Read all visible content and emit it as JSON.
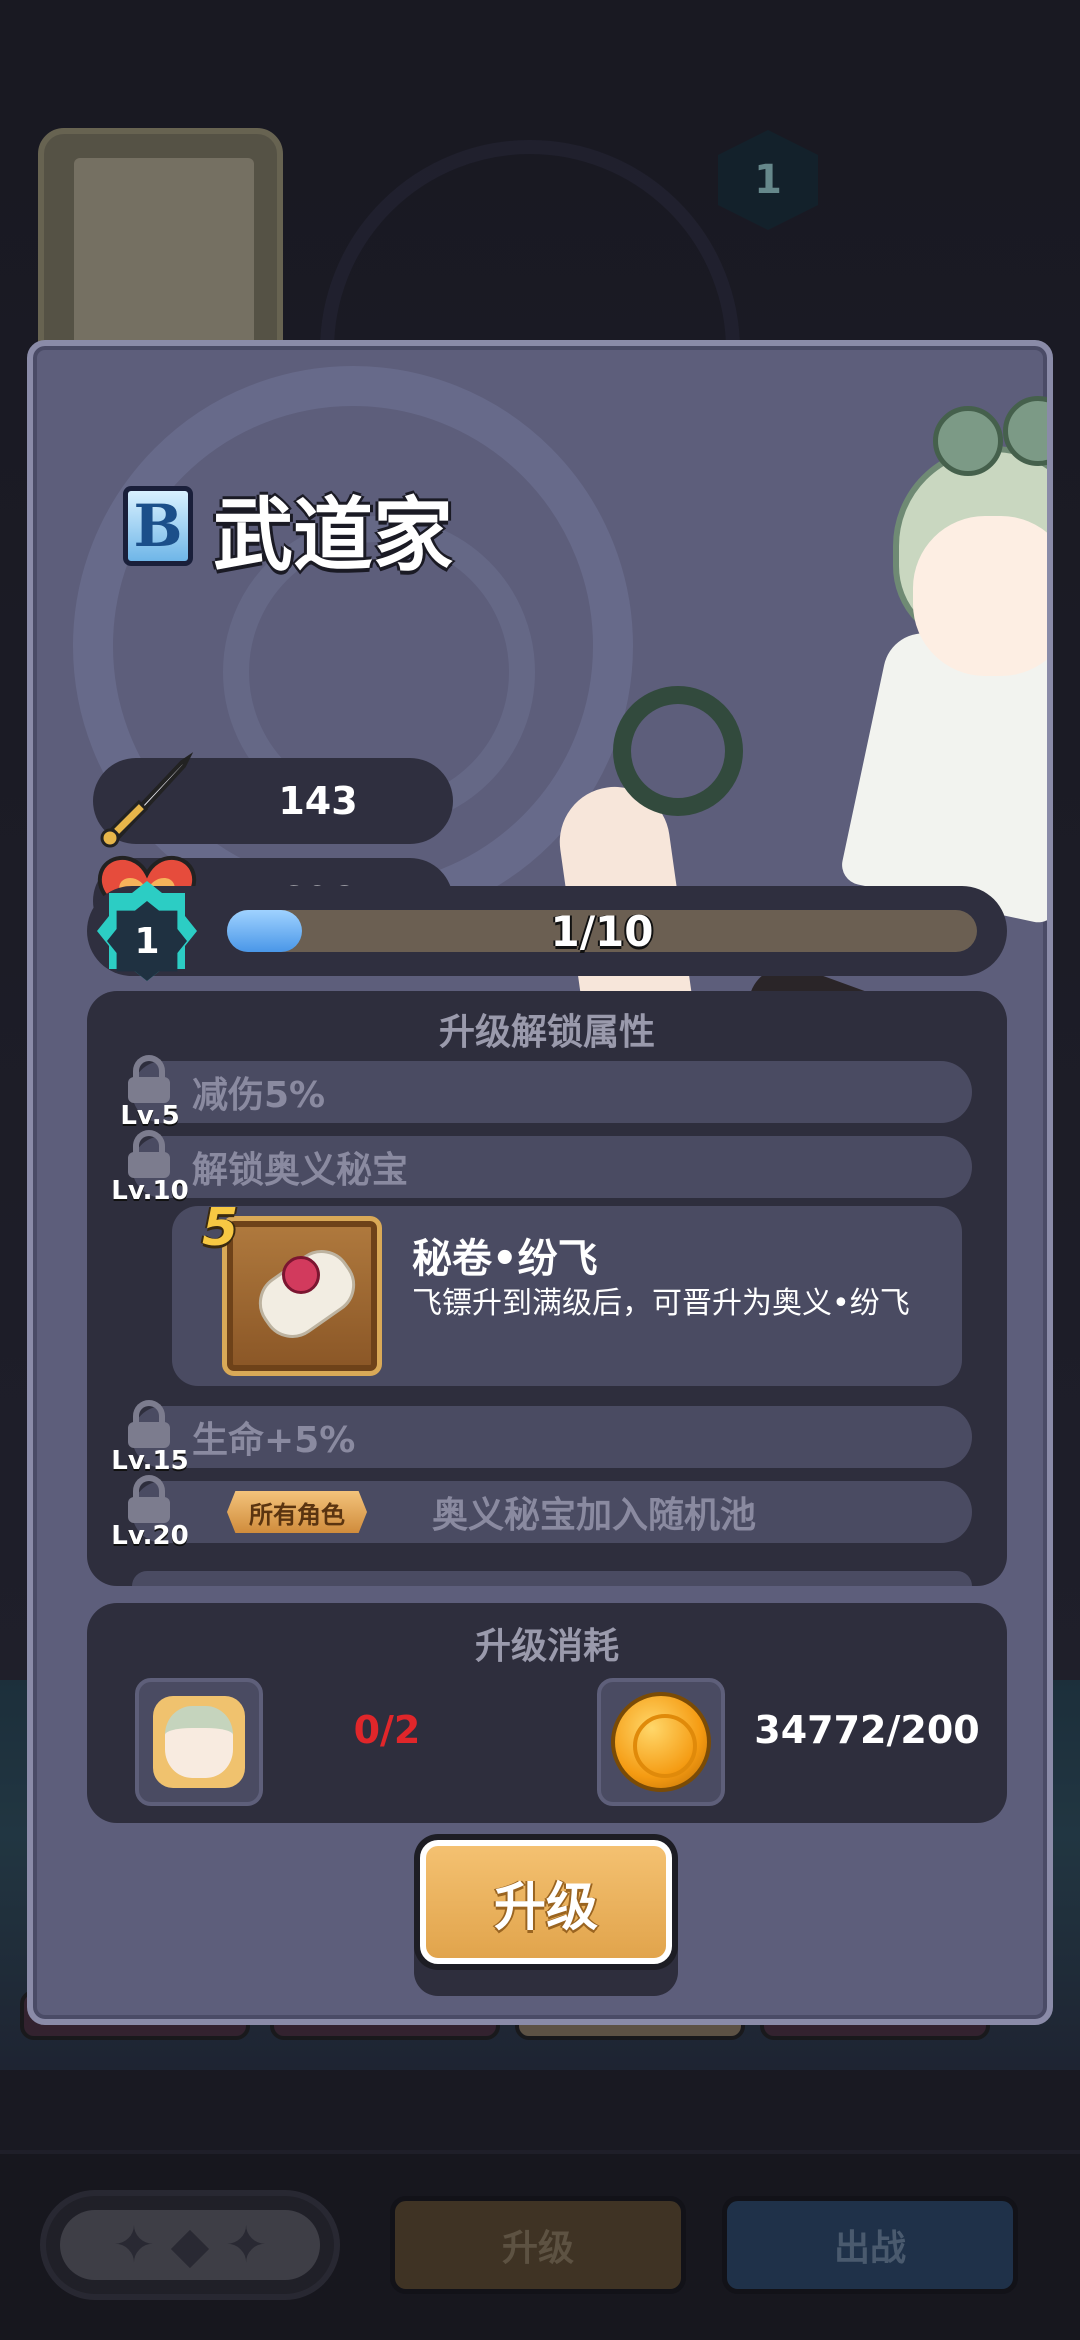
{
  "hero": {
    "grade": "B",
    "name": "武道家",
    "attack": "143",
    "hp": "698",
    "level": "1",
    "xp_text": "1/10",
    "xp_fraction": 0.1
  },
  "unlock": {
    "title": "升级解锁属性",
    "rows": [
      {
        "level": "Lv.5",
        "text": "减伤5%"
      },
      {
        "level": "Lv.10",
        "text": "解锁奥义秘宝"
      },
      {
        "level": "Lv.15",
        "text": "生命+5%"
      },
      {
        "level": "Lv.20",
        "tag": "所有角色",
        "text": "奥义秘宝加入随机池"
      }
    ],
    "reward": {
      "badge_number": "5",
      "title": "秘卷•纷飞",
      "description": "飞镖升到满级后，可晋升为奥义•纷飞"
    }
  },
  "cost": {
    "title": "升级消耗",
    "shards": "0/2",
    "coins": "34772/200"
  },
  "buttons": {
    "upgrade": "升级",
    "bottom_upgrade": "升级",
    "bottom_fight": "出战"
  },
  "background": {
    "hero_level_badge": "1"
  },
  "colors": {
    "panel": "#5d5e7b",
    "box": "#2e2e3d",
    "accent_gold": "#e1a44c",
    "xp_blue": "#4a97e8",
    "warning_red": "#e0262a"
  }
}
